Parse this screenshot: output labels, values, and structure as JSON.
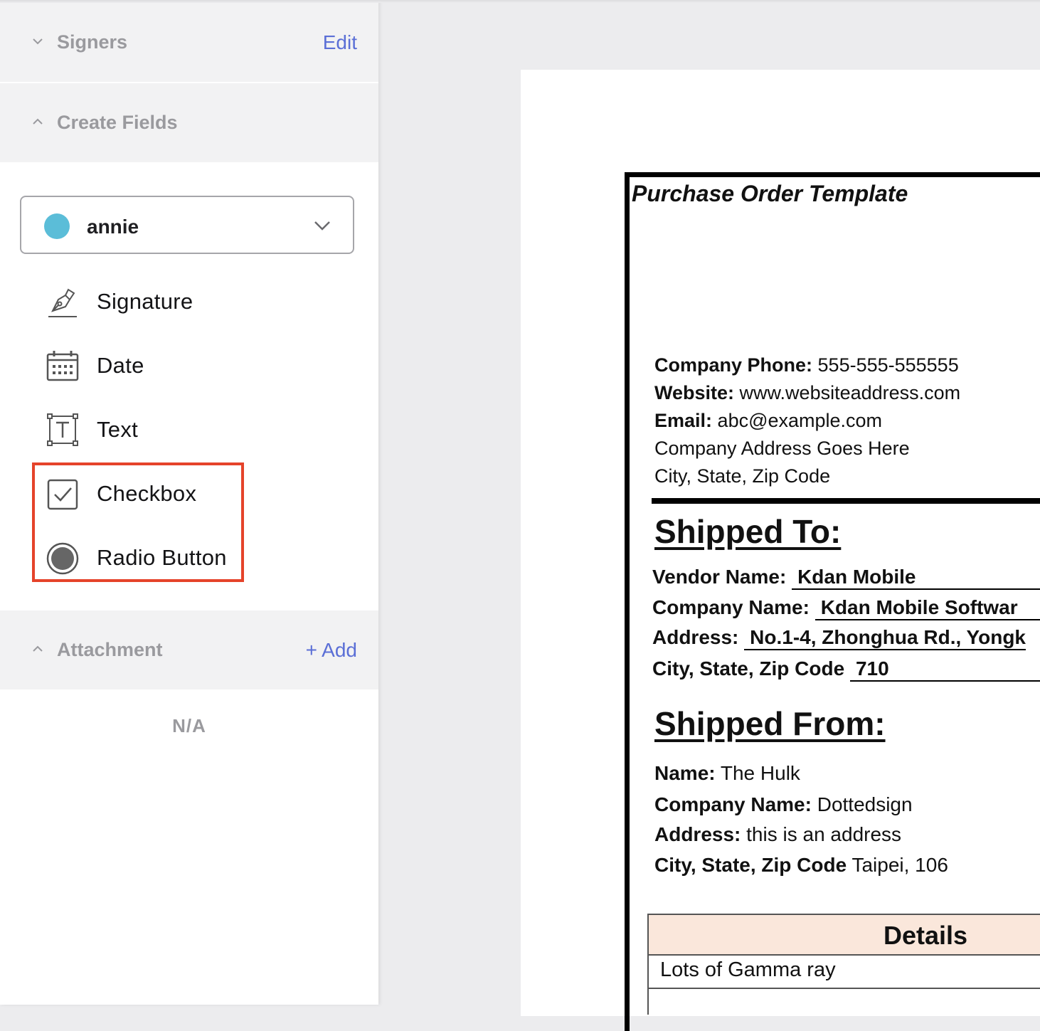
{
  "sidebar": {
    "signers": {
      "title": "Signers",
      "action": "Edit"
    },
    "create_fields": {
      "title": "Create Fields",
      "signer": {
        "name": "annie",
        "color": "#5bbdd8"
      },
      "fields": [
        {
          "label": "Signature",
          "icon": "signature-pen-icon"
        },
        {
          "label": "Date",
          "icon": "calendar-icon"
        },
        {
          "label": "Text",
          "icon": "text-box-icon"
        },
        {
          "label": "Checkbox",
          "icon": "checkbox-icon"
        },
        {
          "label": "Radio Button",
          "icon": "radio-button-icon"
        }
      ],
      "highlight_color": "#e5432a"
    },
    "attachment": {
      "title": "Attachment",
      "action": "+ Add",
      "empty_text": "N/A"
    },
    "accent_color": "#5b6fd6"
  },
  "document": {
    "title": "Purchase Order Template",
    "company": {
      "phone_label": "Company Phone:",
      "phone": "555-555-555555",
      "website_label": "Website:",
      "website": "www.websiteaddress.com",
      "email_label": "Email:",
      "email": "abc@example.com",
      "address": "Company Address Goes Here",
      "city_line": "City, State, Zip Code"
    },
    "shipped_to": {
      "heading": "Shipped To:",
      "vendor_label": "Vendor Name:",
      "vendor": "Kdan Mobile",
      "company_label": "Company Name:",
      "company": "Kdan Mobile Softwar",
      "address_label": "Address:",
      "address": "No.1-4, Zhonghua Rd., Yongk",
      "city_label": "City, State, Zip Code",
      "city": "710"
    },
    "shipped_from": {
      "heading": "Shipped From:",
      "name_label": "Name:",
      "name": "The Hulk",
      "company_label": "Company Name:",
      "company": "Dottedsign",
      "address_label": "Address:",
      "address": "this is an address",
      "city_label": "City, State, Zip Code",
      "city": "Taipei, 106"
    },
    "details": {
      "heading": "Details",
      "rows": [
        "Lots of Gamma ray"
      ],
      "header_color": "#fae7db"
    }
  }
}
